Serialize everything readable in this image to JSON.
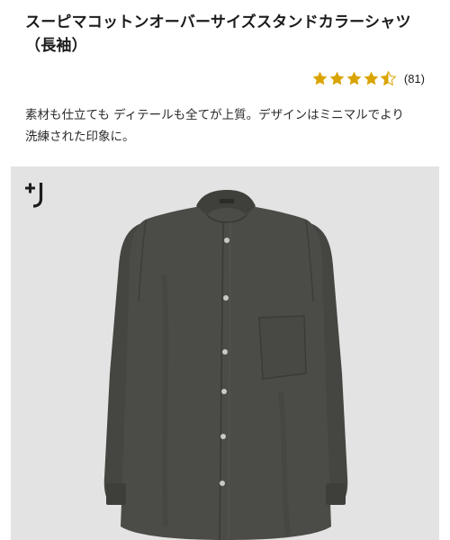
{
  "product": {
    "title": "スーピマコットンオーバーサイズスタンドカラーシャツ\n（長袖）",
    "rating": 4.5,
    "review_count": "(81)",
    "description": "素材も仕立ても ディテールも全てが上質。デザインはミニマルでより\n洗練された印象に。"
  },
  "image": {
    "logo_icon": "plus-j-logo-icon",
    "photo": "stand-collar-shirt-photo",
    "background_color": "#e3e3e3",
    "shirt_color": "#4b4c47"
  },
  "colors": {
    "star": "#d9a400",
    "text": "#1b1b1b"
  }
}
